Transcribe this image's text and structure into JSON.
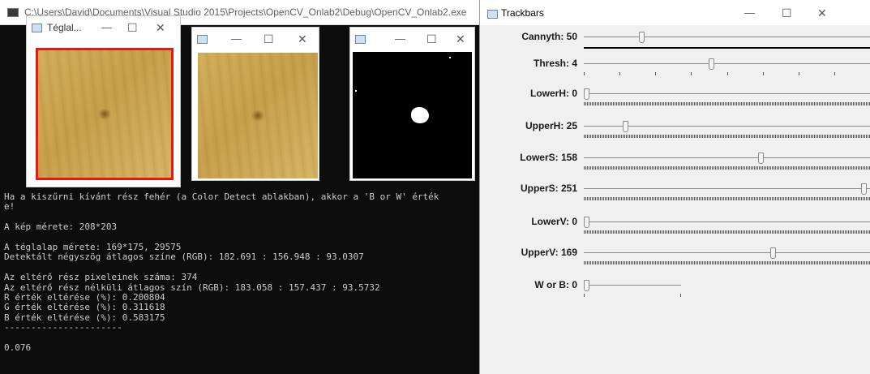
{
  "console": {
    "title": "C:\\Users\\David\\Documents\\Visual Studio 2015\\Projects\\OpenCV_Onlab2\\Debug\\OpenCV_Onlab2.exe",
    "lines": [
      "Ha a kiszűrni kívánt rész fehér (a Color Detect ablakban), akkor a 'B or W' érték",
      "e!",
      "",
      "A kép mérete: 208*203",
      "",
      "A téglalap mérete: 169*175, 29575",
      "Detektált négyszög átlagos színe (RGB): 182.691 : 156.948 : 93.0307",
      "",
      "Az eltérő rész pixeleinek száma: 374",
      "Az eltérő rész nélküli átlagos szín (RGB): 183.058 : 157.437 : 93.5732",
      "R érték eltérése (%): 0.200804",
      "G érték eltérése (%): 0.311618",
      "B érték eltérése (%): 0.583175",
      "----------------------",
      "",
      "0.076"
    ]
  },
  "windows": {
    "rect": {
      "title": "Téglal...",
      "min": "—",
      "max": "☐",
      "close": "✕"
    },
    "orig": {
      "title": "",
      "min": "—",
      "max": "☐",
      "close": "✕"
    },
    "mask": {
      "title": "",
      "min": "—",
      "max": "☐",
      "close": "✕"
    }
  },
  "trackbars": {
    "title": "Trackbars",
    "min": "—",
    "max": "☐",
    "close": "✕",
    "items": [
      {
        "label": "Cannyth: 50",
        "value": 50
      },
      {
        "label": "Thresh: 4",
        "value": 4
      },
      {
        "label": "LowerH: 0",
        "value": 0
      },
      {
        "label": "UpperH: 25",
        "value": 25
      },
      {
        "label": "LowerS: 158",
        "value": 158
      },
      {
        "label": "UpperS: 251",
        "value": 251
      },
      {
        "label": "LowerV: 0",
        "value": 0
      },
      {
        "label": "UpperV: 169",
        "value": 169
      },
      {
        "label": "W or B: 0",
        "value": 0
      }
    ]
  },
  "colors": {
    "rectangle_outline": "#e8170f",
    "console_bg": "#0c0c0c",
    "console_text": "#cccccc"
  }
}
